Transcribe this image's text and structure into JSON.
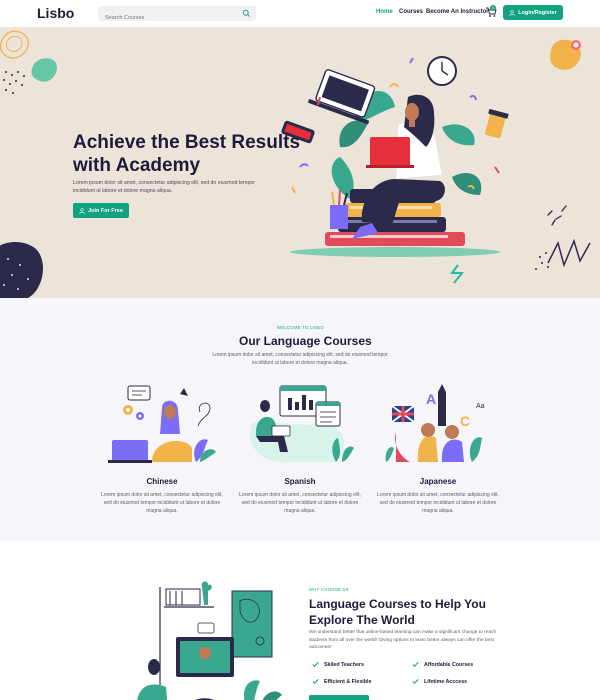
{
  "header": {
    "logo": "Lisbo",
    "search_placeholder": "Search Courses",
    "nav": [
      "Home",
      "Courses",
      "Become An Instructor"
    ],
    "cart_count": "0",
    "login_label": "Login/Register"
  },
  "hero": {
    "title": "Achieve the Best Results with Academy",
    "text": "Lorem ipsum dolor sit amet, consectetur adipiscing elit, sed do eiusmod tempor incididunt ut labore et dolore magna aliqua.",
    "button": "Join For Free"
  },
  "courses": {
    "eyebrow": "WELCOME TO LISBO",
    "title": "Our Language Courses",
    "text": "Lorem ipsum dolor sit amet, consectetur adipiscing elit, sed do eiusmod tempor incididunt ut labore et dolore magna aliqua.",
    "items": [
      {
        "name": "Chinese",
        "desc": "Lorem ipsum dolor sit amet, consectetur adipiscing elit, sed do eiusmod tempor incididunt ut labore et dolore magna aliqua."
      },
      {
        "name": "Spanish",
        "desc": "Lorem ipsum dolor sit amet, consectetur adipiscing elit, sed do eiusmod tempor incididunt ut labore et dolore magna aliqua."
      },
      {
        "name": "Japanese",
        "desc": "Lorem ipsum dolor sit amet, consectetur adipiscing elit, sed do eiusmod tempor incididunt ut labore et dolore magna aliqua."
      }
    ]
  },
  "why": {
    "eyebrow": "WHY CHOOSE US",
    "title": "Language Courses to Help You Explore The World",
    "text": "We understand better that online-based learning can make a significant change to reach students from all over the world! Giving options to learn better always can offer the best outcomes!",
    "features": [
      "Skiled Teachers",
      "Affordable Courses",
      "Efficient & Flexible",
      "Lifetime Acccess"
    ]
  },
  "colors": {
    "accent": "#11a37f",
    "hero_bg": "#ede4d9",
    "section_bg": "#f6f6fa",
    "heading": "#1e1b3a"
  },
  "icons": [
    "search-icon",
    "cart-icon",
    "user-icon",
    "check-icon"
  ]
}
